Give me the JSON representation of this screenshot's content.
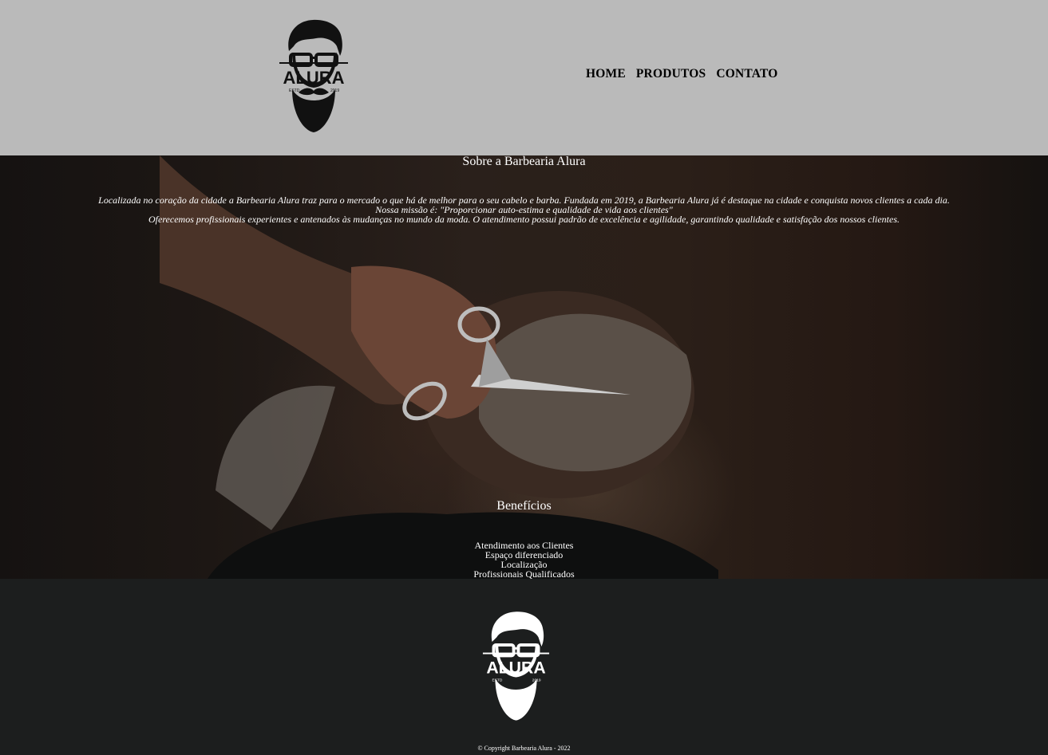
{
  "header": {
    "logo": {
      "brand": "ALURA",
      "estd": "ESTD",
      "year": "2019",
      "icon": "bearded-man-logo"
    },
    "nav": [
      "HOME",
      "PRODUTOS",
      "CONTATO"
    ]
  },
  "sobre": {
    "title": "Sobre a Barbearia Alura",
    "paragraphs": [
      "Localizada no coração da cidade a Barbearia Alura traz para o mercado o que há de melhor para o seu cabelo e barba. Fundada em 2019, a Barbearia Alura já é destaque na cidade e conquista novos clientes a cada dia.",
      "Nossa missão é: \"Proporcionar auto-estima e qualidade de vida aos clientes\"",
      "Oferecemos profissionais experientes e antenados às mudanças no mundo da moda. O atendimento possui padrão de excelência e agilidade, garantindo qualidade e satisfação dos nossos clientes."
    ]
  },
  "beneficios": {
    "title": "Benefícios",
    "items": [
      "Atendimento aos Clientes",
      "Espaço diferenciado",
      "Localização",
      "Profissionais Qualificados"
    ]
  },
  "footer": {
    "logo": {
      "brand": "ALURA",
      "estd": "ESTD",
      "year": "2019",
      "icon": "bearded-man-logo"
    },
    "copyright": "© Copyright Barbearia Alura - 2022"
  },
  "colors": {
    "header_bg": "#bababa",
    "footer_bg": "#1c1e1e",
    "text_light": "#ffffff"
  }
}
